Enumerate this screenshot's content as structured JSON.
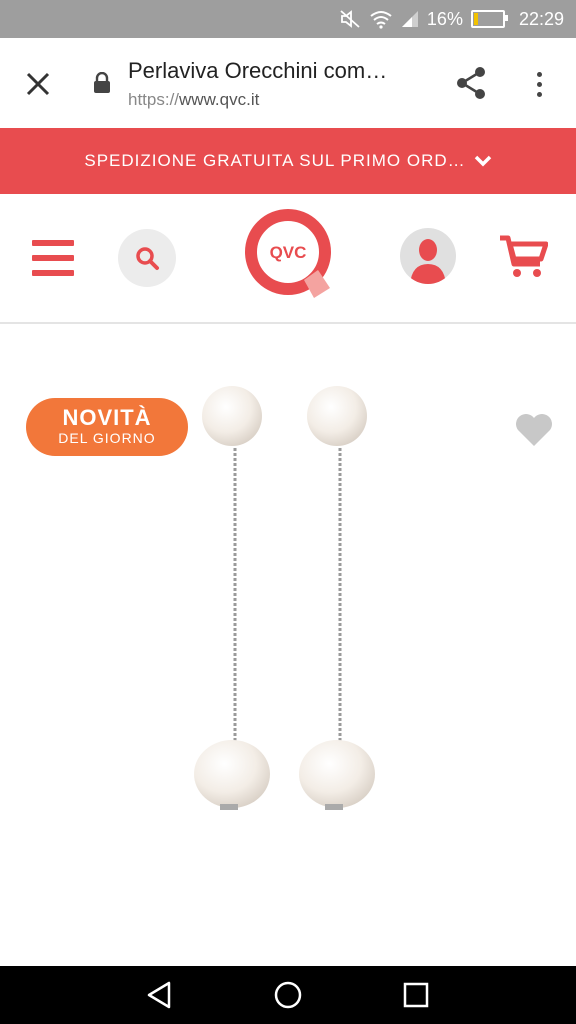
{
  "status_bar": {
    "battery": "16%",
    "time": "22:29",
    "battery_level": 0.16
  },
  "browser": {
    "page_title": "Perlaviva Orecchini com…",
    "url_scheme": "https://",
    "url_host": "www.qvc.it"
  },
  "promo_banner": {
    "text": "SPEDIZIONE GRATUITA SUL PRIMO ORD…"
  },
  "header": {
    "logo_text": "QVC"
  },
  "product": {
    "badge_line1": "NOVITÀ",
    "badge_line2": "DEL GIORNO"
  },
  "colors": {
    "brand_red": "#e84c4f",
    "badge_orange": "#f2773a",
    "status_bar_gray": "#9e9e9e"
  },
  "icons": [
    "close-icon",
    "lock-icon",
    "share-icon",
    "more-vert-icon",
    "chevron-down-icon",
    "hamburger-menu-icon",
    "search-icon",
    "account-icon",
    "cart-icon",
    "favorite-heart-icon",
    "back-icon",
    "home-icon",
    "recents-icon"
  ]
}
